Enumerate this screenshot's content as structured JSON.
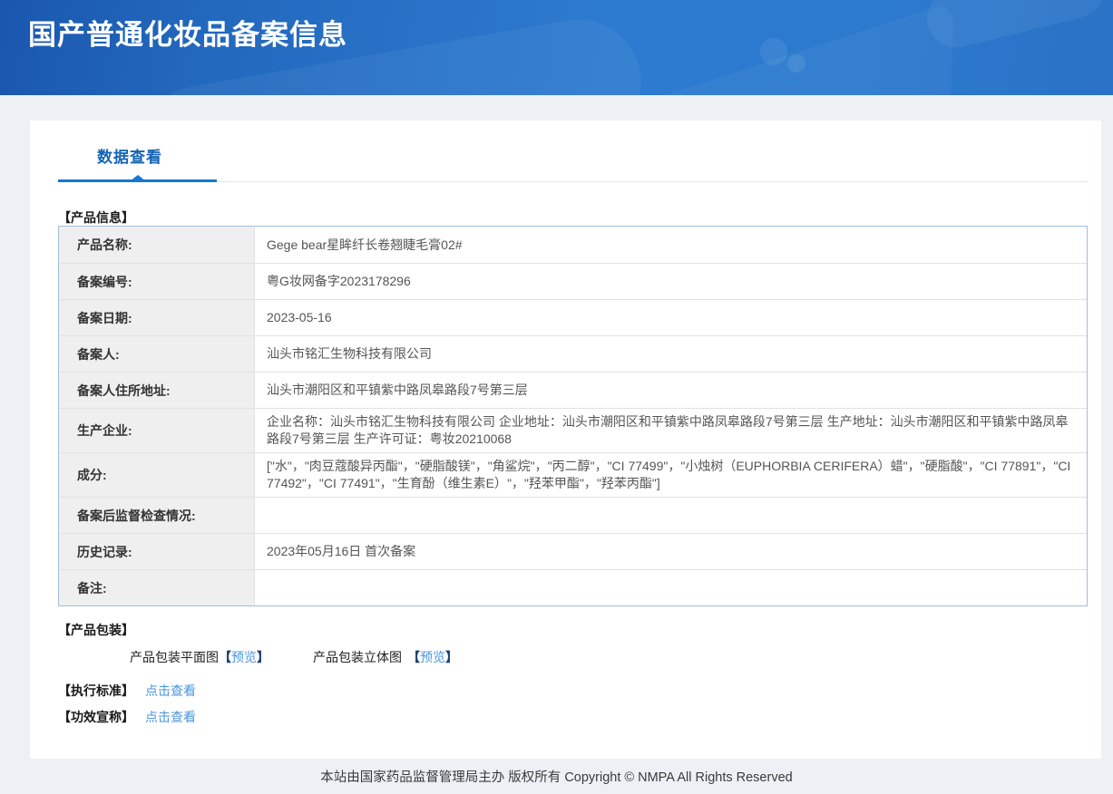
{
  "header": {
    "title": "国产普通化妆品备案信息"
  },
  "tabs": {
    "data_view": "数据查看"
  },
  "product_info": {
    "section_title": "【产品信息】",
    "rows": [
      {
        "label": "产品名称:",
        "value": "Gege bear星眸纤长卷翘睫毛膏02#"
      },
      {
        "label": "备案编号:",
        "value": "粤G妆网备字2023178296"
      },
      {
        "label": "备案日期:",
        "value": "2023-05-16"
      },
      {
        "label": "备案人:",
        "value": "汕头市铭汇生物科技有限公司"
      },
      {
        "label": "备案人住所地址:",
        "value": "汕头市潮阳区和平镇紫中路凤皋路段7号第三层"
      },
      {
        "label": "生产企业:",
        "value": "企业名称：汕头市铭汇生物科技有限公司 企业地址：汕头市潮阳区和平镇紫中路凤皋路段7号第三层 生产地址：汕头市潮阳区和平镇紫中路凤皋路段7号第三层 生产许可证：粤妆20210068"
      },
      {
        "label": "成分:",
        "value": "[\"水\"，\"肉豆蔻酸异丙酯\"，\"硬脂酸镁\"，\"角鲨烷\"，\"丙二醇\"，\"CI 77499\"，\"小烛树（EUPHORBIA CERIFERA）蜡\"，\"硬脂酸\"，\"CI 77891\"，\"CI 77492\"，\"CI 77491\"，\"生育酚（维生素E）\"，\"羟苯甲酯\"，\"羟苯丙酯\"]"
      },
      {
        "label": "备案后监督检查情况:",
        "value": ""
      },
      {
        "label": "历史记录:",
        "value": "2023年05月16日 首次备案"
      },
      {
        "label": "备注:",
        "value": ""
      }
    ]
  },
  "packaging": {
    "section_title": "【产品包装】",
    "items": [
      {
        "label": "产品包装平面图",
        "bracket_open": "【",
        "link": "预览",
        "bracket_close": "】"
      },
      {
        "label": "产品包装立体图",
        "bracket_open": "【",
        "link": "预览",
        "bracket_close": "】"
      }
    ]
  },
  "standard": {
    "title": "【执行标准】",
    "link": "点击查看"
  },
  "efficacy": {
    "title": "【功效宣称】",
    "link": "点击查看"
  },
  "footer": {
    "text": "本站由国家药品监督管理局主办 版权所有 Copyright © NMPA All Rights Reserved"
  },
  "colors": {
    "header_gradient_start": "#1a57ae",
    "header_gradient_end": "#2d7bd0",
    "tab_blue": "#1464b4",
    "underline_blue": "#1678d3",
    "link_blue": "#4a96dd",
    "table_border": "#a2bede",
    "label_cell_bg": "#efefef",
    "page_bg": "#edf1f6"
  }
}
